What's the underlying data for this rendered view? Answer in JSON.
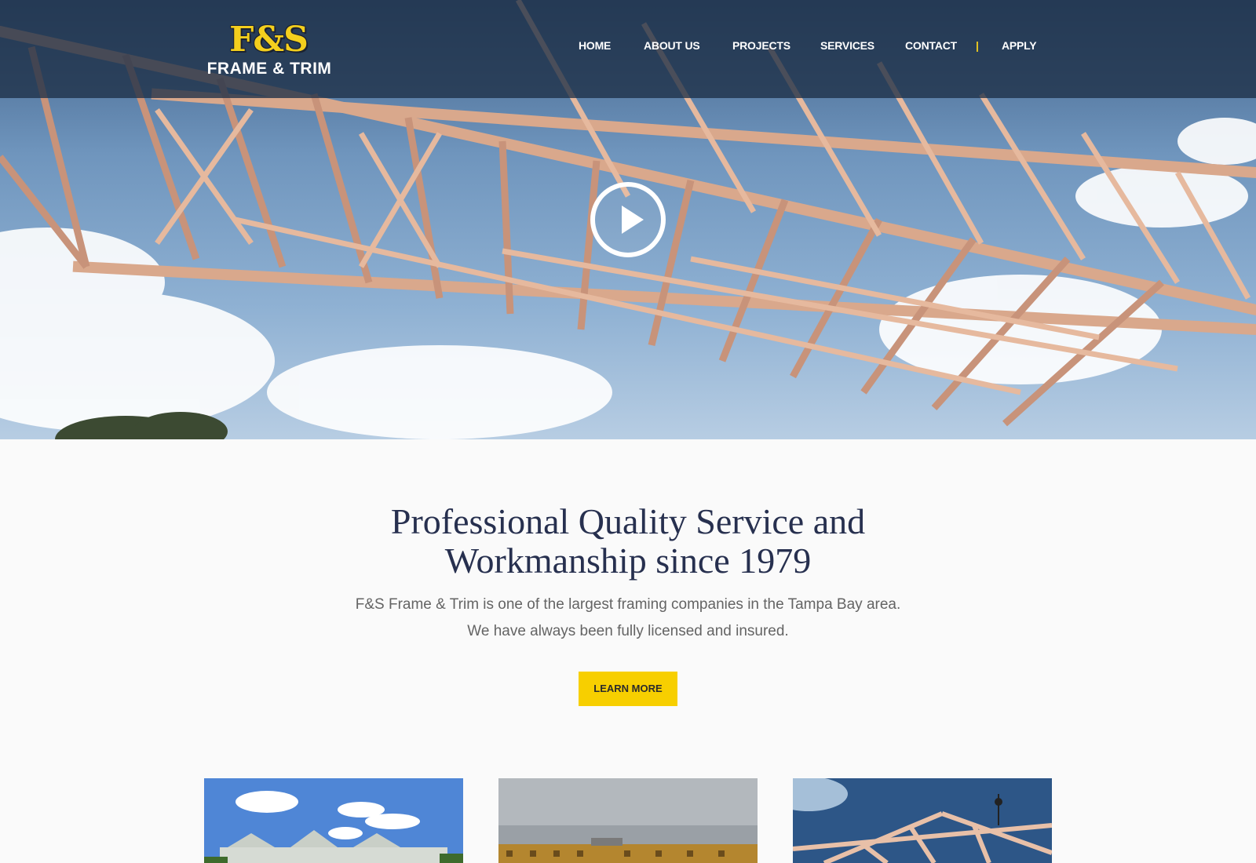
{
  "brand": {
    "logo_top": "F&S",
    "logo_bottom": "FRAME & TRIM",
    "logo_color": "#f4cf1d"
  },
  "nav": {
    "items": [
      "HOME",
      "ABOUT US",
      "PROJECTS",
      "SERVICES",
      "CONTACT"
    ],
    "separator": "|",
    "apply": "APPLY"
  },
  "hero": {
    "media": "roof-truss-video",
    "play_icon": "play-circle-icon"
  },
  "intro": {
    "heading": "Professional Quality Service and Workmanship since 1979",
    "body": "F&S Frame & Trim is one of the largest framing companies in the Tampa Bay area. We have always been fully licensed and insured.",
    "cta": "LEARN MORE",
    "cta_color": "#f7cf00",
    "heading_color": "#27304f"
  },
  "cards": [
    {
      "image": "white-mansion-photo"
    },
    {
      "image": "apartment-framing-photo"
    },
    {
      "image": "truss-lift-photo"
    }
  ]
}
